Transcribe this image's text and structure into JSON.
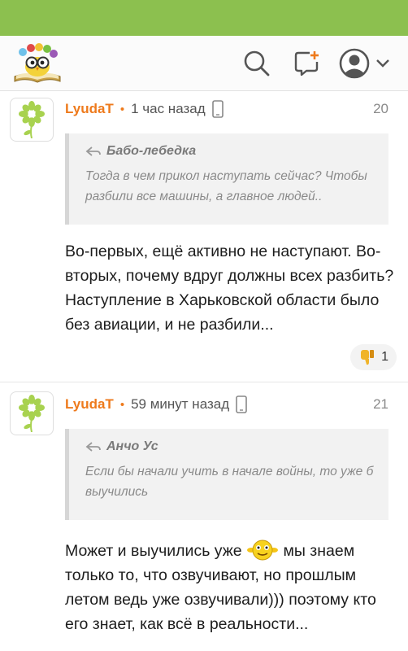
{
  "colors": {
    "statusbar": "#8cc04f",
    "accent": "#ee7a1c",
    "quote_bg": "#f2f2f2"
  },
  "header": {
    "logo_icon": "owl-book-logo-icon",
    "search_icon": "search-icon",
    "compose_icon": "new-message-icon",
    "profile_icon": "user-avatar-icon",
    "dropdown_icon": "chevron-down-icon"
  },
  "comments": [
    {
      "author": "LyudaT",
      "time": "1 час назад",
      "device_icon": "mobile-phone-icon",
      "number": "20",
      "quote": {
        "author": "Бабо-лебедка",
        "text": "Тогда в чем прикол наступать сейчас? Чтобы разбили все машины, а главное людей.."
      },
      "text": "Во-первых, ещё активно не наступают. Во-вторых, почему вдруг должны всех разбить? Наступление в Харьковской области было без авиации, и не разбили...",
      "reaction": {
        "icon": "thumbs-down-icon",
        "count": "1"
      }
    },
    {
      "author": "LyudaT",
      "time": "59 минут назад",
      "device_icon": "mobile-phone-icon",
      "number": "21",
      "quote": {
        "author": "Анчо Ус",
        "text": "Если бы начали учить в начале войны, то уже б выучились"
      },
      "text_before_emoji": "Может и выучились уже ",
      "emoji_icon": "smiley-emoji-icon",
      "text_after_emoji": " мы знаем только то, что озвучивают, но прошлым летом ведь уже озвучивали))) поэтому кто его знает, как всё в реальности..."
    }
  ]
}
